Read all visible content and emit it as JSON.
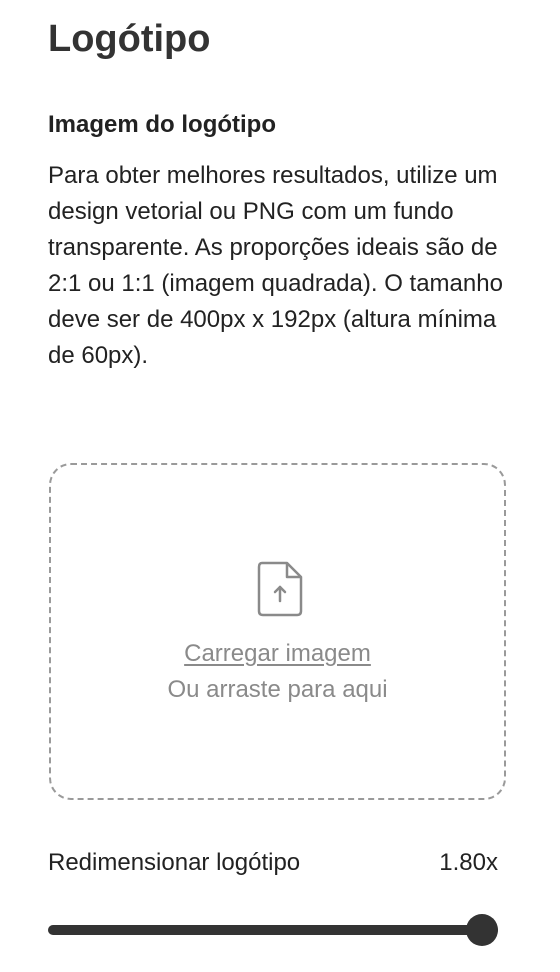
{
  "logo_section": {
    "title": "Logótipo",
    "image_heading": "Imagem do logótipo",
    "description": "Para obter melhores resultados, utilize um design vetorial ou PNG com um fundo transparente. As proporções ideais são de 2:1 ou 1:1 (imagem quadrada). O tamanho deve ser de 400px x 192px (altura mínima de 60px)."
  },
  "upload": {
    "icon": "file-upload-icon",
    "link_label": "Carregar imagem",
    "hint": "Ou arraste para aqui"
  },
  "resize": {
    "label": "Redimensionar logótipo",
    "value_label": "1.80x",
    "slider_fraction": 1.0
  },
  "colors": {
    "text": "#222222",
    "muted": "#8a8a8a",
    "slider": "#333333",
    "dashed_border": "#9a9a9a"
  }
}
